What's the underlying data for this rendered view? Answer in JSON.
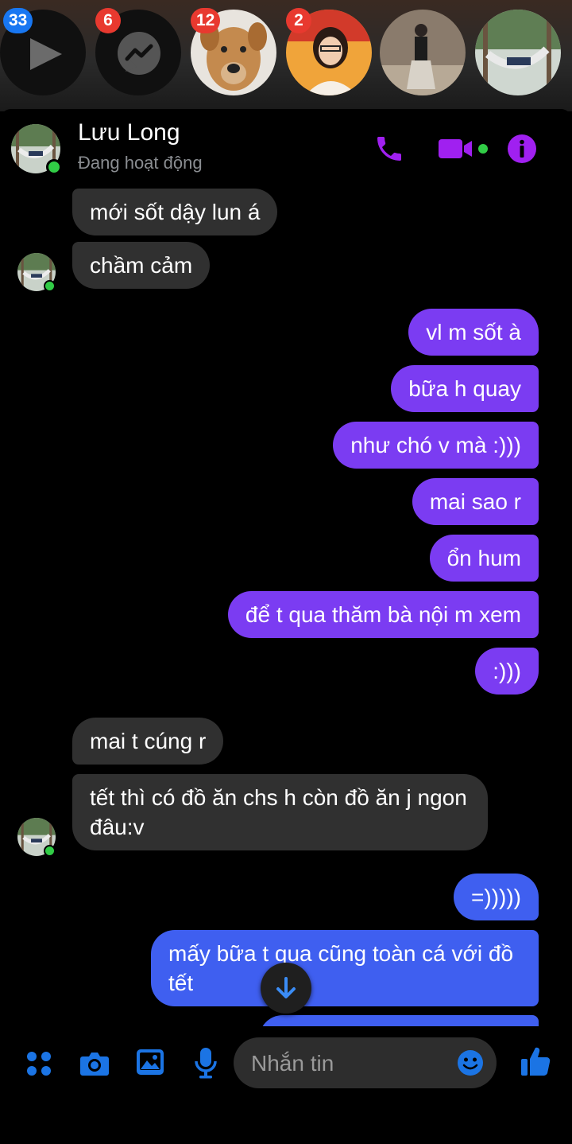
{
  "bubble_heads": [
    {
      "name": "play-head",
      "badge": "33",
      "badge_color": "#1877f2"
    },
    {
      "name": "messenger-head",
      "badge": "6",
      "badge_color": "#e8392f"
    },
    {
      "name": "dog-head",
      "badge": "12",
      "badge_color": "#e8392f"
    },
    {
      "name": "girl-head",
      "badge": "2",
      "badge_color": "#e8392f"
    },
    {
      "name": "person-head",
      "badge": null
    },
    {
      "name": "hammock-head",
      "badge": null
    }
  ],
  "header": {
    "contact_name": "Lưu Long",
    "status": "Đang hoạt động"
  },
  "messages": [
    {
      "side": "in",
      "text": "mới sốt dậy lun á"
    },
    {
      "side": "in",
      "text": "chầm cảm"
    },
    {
      "side": "out",
      "text": "vl m sốt à"
    },
    {
      "side": "out",
      "text": "bữa h quay"
    },
    {
      "side": "out",
      "text": "như chó v mà :)))"
    },
    {
      "side": "out",
      "text": "mai sao r"
    },
    {
      "side": "out",
      "text": "ổn hum"
    },
    {
      "side": "out",
      "text": "để t qua thăm bà nội m xem"
    },
    {
      "side": "out",
      "text": ":)))"
    },
    {
      "side": "in",
      "text": "mai t cúng r"
    },
    {
      "side": "in",
      "text": "tết thì có đồ ăn chs h còn đồ ăn j ngon đâu:v"
    },
    {
      "side": "out",
      "text": "=)))))"
    },
    {
      "side": "out",
      "text": "mấy bữa t qua cũng toàn cá với đồ tết"
    }
  ],
  "composer": {
    "placeholder": "Nhắn tin"
  },
  "colors": {
    "accent_purple": "#a020f0",
    "outgoing_purple": "#7b3cf2",
    "outgoing_blue": "#3f5ff0",
    "incoming_gray": "#303030",
    "online_green": "#31cc46",
    "composer_blue": "#1b74e4"
  }
}
